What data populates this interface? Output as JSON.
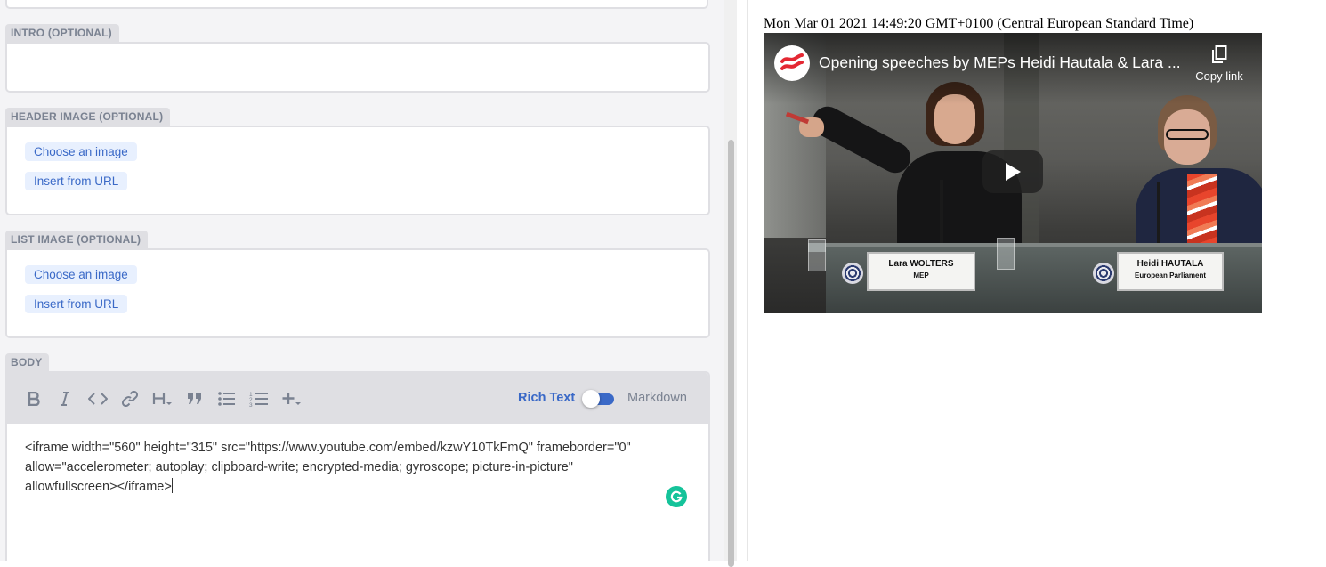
{
  "editor": {
    "intro_label": "INTRO (OPTIONAL)",
    "header_image": {
      "label": "HEADER IMAGE (OPTIONAL)",
      "choose_label": "Choose an image",
      "insert_label": "Insert from URL"
    },
    "list_image": {
      "label": "LIST IMAGE (OPTIONAL)",
      "choose_label": "Choose an image",
      "insert_label": "Insert from URL"
    },
    "body": {
      "label": "BODY",
      "toolbar": {
        "bold_icon": "bold-icon",
        "italic_icon": "italic-icon",
        "code_icon": "code-icon",
        "link_icon": "link-icon",
        "heading_icon": "heading-icon",
        "quote_icon": "quote-icon",
        "bulleted_list_icon": "bulleted-list-icon",
        "numbered_list_icon": "numbered-list-icon",
        "add_icon": "plus-icon",
        "rich_text_label": "Rich Text",
        "markdown_label": "Markdown",
        "mode": "Rich Text"
      },
      "content_lines": [
        "<iframe width=\"560\" height=\"315\" src=\"https://www.youtube.com/embed/kzwY10TkFmQ\" frameborder=\"0\"",
        "allow=\"accelerometer; autoplay; clipboard-write; encrypted-media; gyroscope; picture-in-picture\"",
        "allowfullscreen></iframe>"
      ]
    },
    "accent_color": "#3a69c7"
  },
  "preview": {
    "date": "Mon Mar 01 2021 14:49:20 GMT+0100 (Central European Standard Time)",
    "video": {
      "title": "Opening speeches by MEPs Heidi Hautala & Lara ...",
      "copy_link_label": "Copy link",
      "nameplate_left_name": "Lara WOLTERS",
      "nameplate_left_role": "MEP",
      "nameplate_right_name": "Heidi HAUTALA",
      "nameplate_right_role": "European Parliament"
    }
  }
}
